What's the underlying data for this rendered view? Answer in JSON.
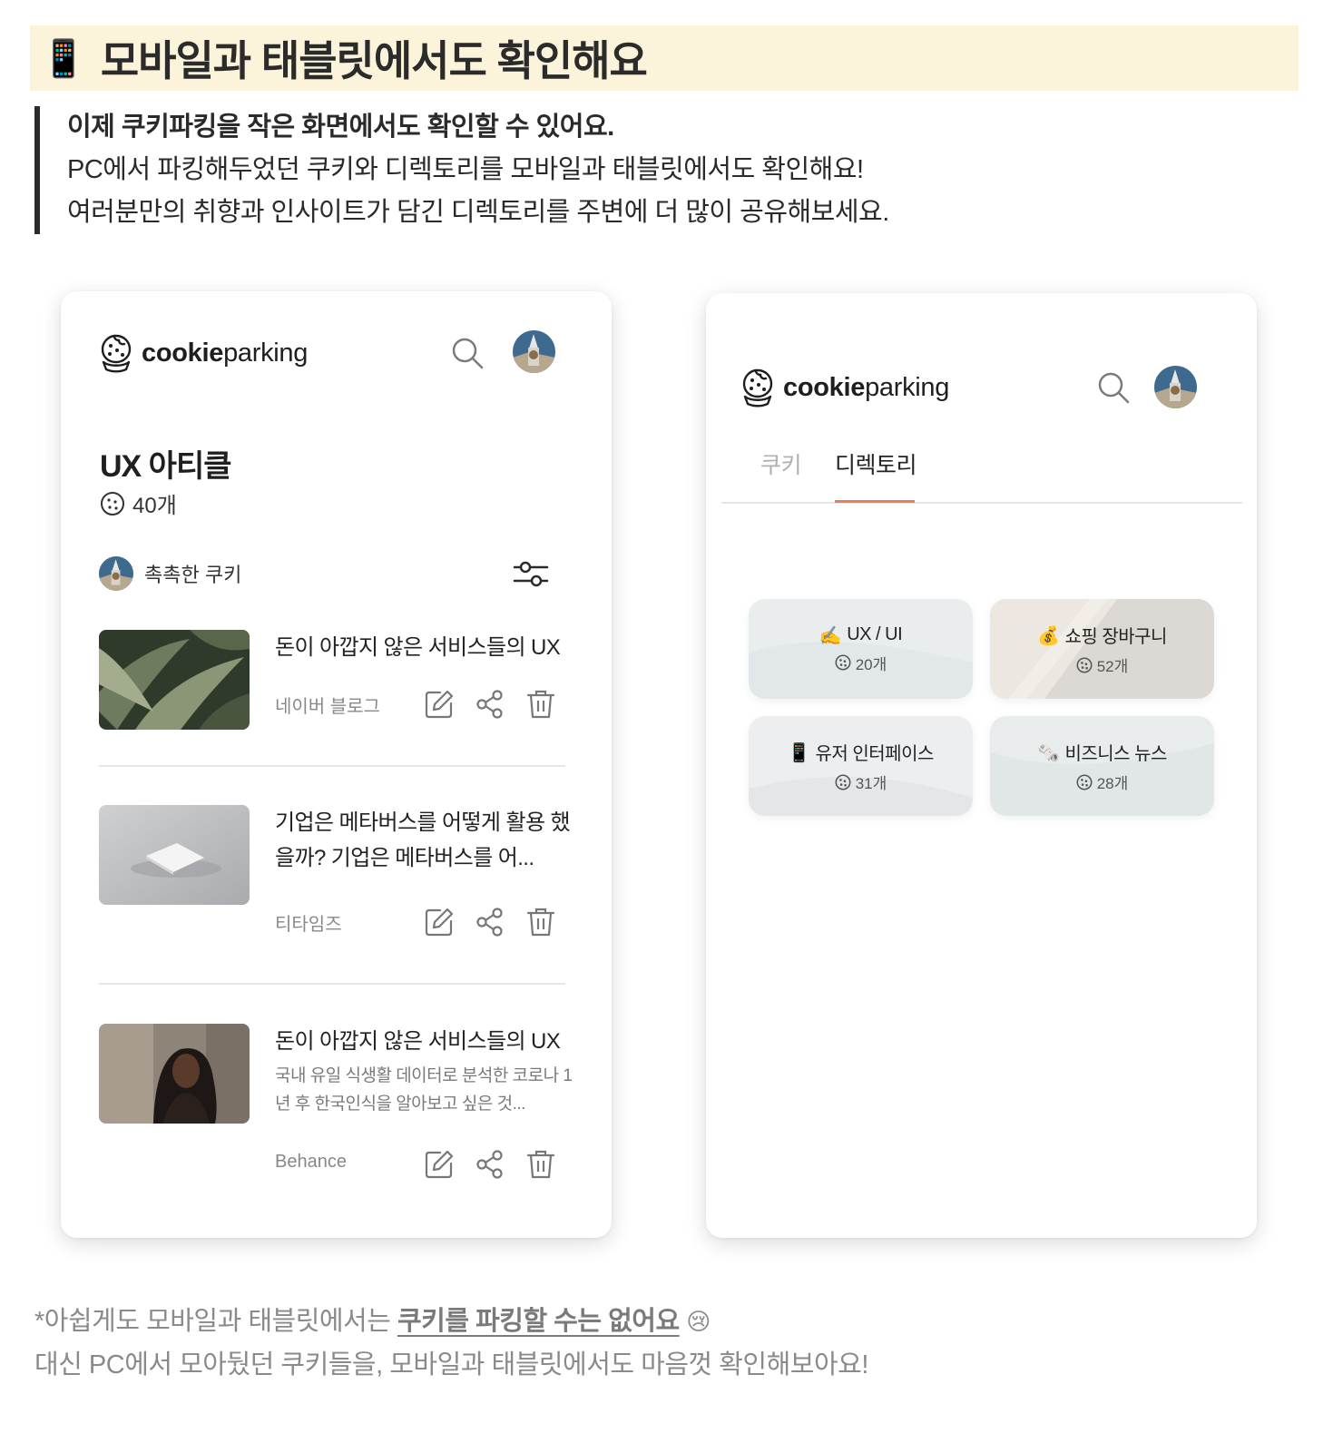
{
  "section": {
    "emoji": "📱",
    "title": "모바일과 태블릿에서도 확인해요"
  },
  "intro": {
    "line1": "이제 쿠키파킹을 작은 화면에서도 확인할 수 있어요.",
    "line2": "PC에서 파킹해두었던 쿠키와 디렉토리를 모바일과 태블릿에서도 확인해요!",
    "line3": "여러분만의 취향과 인사이트가 담긴 디렉토리를 주변에 더 많이 공유해보세요."
  },
  "brand": {
    "bold": "cookie",
    "light": "parking"
  },
  "directory_view": {
    "title": "UX 아티클",
    "cookie_count": "40개",
    "owner_name": "촉촉한 쿠키",
    "articles": [
      {
        "title": "돈이 아깝지 않은 서비스들의 UX",
        "desc": "",
        "source": "네이버 블로그"
      },
      {
        "title": "기업은 메타버스를 어떻게 활용 했을까? 기업은 메타버스를 어...",
        "desc": "",
        "source": "티타임즈"
      },
      {
        "title": "돈이 아깝지 않은 서비스들의 UX",
        "desc": "국내 유일 식생활 데이터로 분석한 코로나 1년 후 한국인식을 알아보고 싶은 것...",
        "source": "Behance"
      }
    ]
  },
  "profile_view": {
    "tabs": [
      "쿠키",
      "디렉토리"
    ],
    "active_tab": "디렉토리",
    "directories": [
      {
        "emoji": "✍️",
        "name": "UX / UI",
        "count": "20개"
      },
      {
        "emoji": "💰",
        "name": "쇼핑 장바구니",
        "count": "52개"
      },
      {
        "emoji": "📱",
        "name": "유저 인터페이스",
        "count": "31개"
      },
      {
        "emoji": "🗞️",
        "name": "비즈니스 뉴스",
        "count": "28개"
      }
    ]
  },
  "footnote": {
    "prefix": "*아쉽게도 모바일과 태블릿에서는 ",
    "emphasis": "쿠키를 파킹할 수는 없어요",
    "emoji": "😢",
    "line2": "대신 PC에서 모아뒀던 쿠키들을, 모바일과 태블릿에서도 마음껏 확인해보아요!"
  },
  "colors": {
    "heading_bg": "#fbf3da",
    "tab_underline": "#e4805a",
    "text_primary": "#222222",
    "text_muted": "#8a8a8a"
  },
  "icons": [
    "cookie-logo-icon",
    "search-icon",
    "avatar",
    "cookie-icon",
    "filter-icon",
    "edit-icon",
    "share-icon",
    "trash-icon"
  ]
}
